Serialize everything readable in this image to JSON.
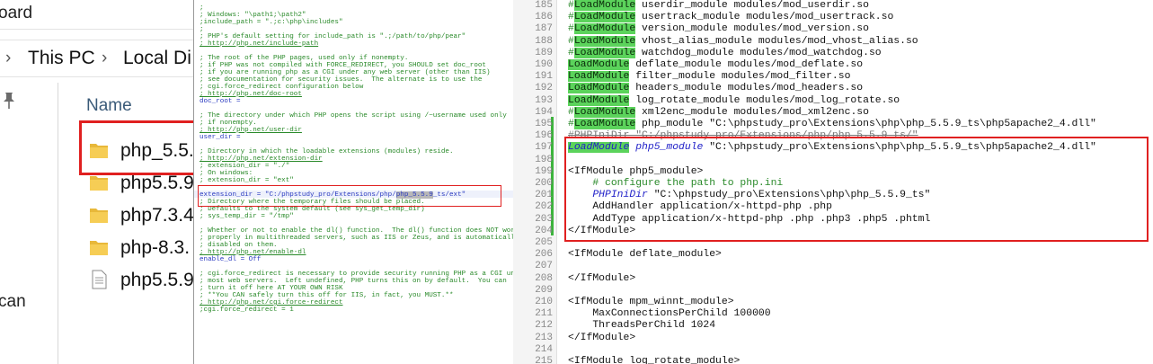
{
  "explorer": {
    "top_partial": "oard",
    "breadcrumb": [
      "This PC",
      "Local Di"
    ],
    "nav_partial": "can",
    "column_header": "Name",
    "files": [
      {
        "name": "php_5.5.",
        "type": "folder"
      },
      {
        "name": "php5.5.9",
        "type": "folder"
      },
      {
        "name": "php7.3.4",
        "type": "folder"
      },
      {
        "name": "php-8.3.",
        "type": "folder"
      },
      {
        "name": "php5.5.9",
        "type": "file"
      }
    ]
  },
  "phpini": {
    "lines": [
      {
        "t": ";",
        "c": "c"
      },
      {
        "t": "; Windows: \"\\path1;\\path2\"",
        "c": "c"
      },
      {
        "t": ";include_path = \".;c:\\php\\includes\"",
        "c": "c"
      },
      {
        "t": ";",
        "c": "c"
      },
      {
        "t": "; PHP's default setting for include_path is \".;/path/to/php/pear\"",
        "c": "c"
      },
      {
        "t": "; http://php.net/include-path",
        "c": "u"
      },
      {
        "t": "",
        "c": "c"
      },
      {
        "t": "; The root of the PHP pages, used only if nonempty.",
        "c": "c"
      },
      {
        "t": "; if PHP was not compiled with FORCE_REDIRECT, you SHOULD set doc_root",
        "c": "c"
      },
      {
        "t": "; if you are running php as a CGI under any web server (other than IIS)",
        "c": "c"
      },
      {
        "t": "; see documentation for security issues.  The alternate is to use the",
        "c": "c"
      },
      {
        "t": "; cgi.force_redirect configuration below",
        "c": "c"
      },
      {
        "t": "; http://php.net/doc-root",
        "c": "u"
      },
      {
        "t": "doc_root =",
        "c": "k"
      },
      {
        "t": "",
        "c": "c"
      },
      {
        "t": "; The directory under which PHP opens the script using /~username used only",
        "c": "c"
      },
      {
        "t": "; if nonempty.",
        "c": "c"
      },
      {
        "t": "; http://php.net/user-dir",
        "c": "u"
      },
      {
        "t": "user_dir =",
        "c": "k"
      },
      {
        "t": "",
        "c": "c"
      },
      {
        "t": "; Directory in which the loadable extensions (modules) reside.",
        "c": "c"
      },
      {
        "t": "; http://php.net/extension-dir",
        "c": "u"
      },
      {
        "t": "; extension_dir = \"./\"",
        "c": "c"
      },
      {
        "t": "; On windows:",
        "c": "c"
      },
      {
        "t": "; extension_dir = \"ext\"",
        "c": "c"
      },
      {
        "t": "",
        "c": "c"
      },
      {
        "t": "; Directory where the temporary files should be placed.",
        "c": "c"
      },
      {
        "t": "; Defaults to the system default (see sys_get_temp_dir)",
        "c": "c"
      },
      {
        "t": "; sys_temp_dir = \"/tmp\"",
        "c": "c"
      },
      {
        "t": "",
        "c": "c"
      },
      {
        "t": "; Whether or not to enable the dl() function.  The dl() function does NOT work",
        "c": "c"
      },
      {
        "t": "; properly in multithreaded servers, such as IIS or Zeus, and is automatically",
        "c": "c"
      },
      {
        "t": "; disabled on them.",
        "c": "c"
      },
      {
        "t": "; http://php.net/enable-dl",
        "c": "u"
      },
      {
        "t": "enable_dl = Off",
        "c": "k"
      },
      {
        "t": "",
        "c": "c"
      },
      {
        "t": "; cgi.force_redirect is necessary to provide security running PHP as a CGI under",
        "c": "c"
      },
      {
        "t": "; most web servers.  Left undefined, PHP turns this on by default.  You can",
        "c": "c"
      },
      {
        "t": "; turn it off here AT YOUR OWN RISK",
        "c": "c"
      },
      {
        "t": "; **You CAN safely turn this off for IIS, in fact, you MUST.**",
        "c": "c"
      },
      {
        "t": "; http://php.net/cgi.force-redirect",
        "c": "u"
      },
      {
        "t": ";cgi.force_redirect = 1",
        "c": "c"
      }
    ],
    "extension_dir_prefix": "extension_dir",
    "extension_dir_eq": " = \"C:/phpstudy_pro/Extensions/php/",
    "extension_dir_hl": "php_5.5.9",
    "extension_dir_suffix": "_ts/ext\""
  },
  "editor": {
    "line_numbers": [
      "185",
      "186",
      "187",
      "188",
      "189",
      "190",
      "191",
      "192",
      "193",
      "194",
      "195",
      "196",
      "197",
      "198",
      "199",
      "200",
      "201",
      "202",
      "203",
      "204",
      "205",
      "206",
      "207",
      "208",
      "209",
      "210",
      "211",
      "212",
      "213",
      "214",
      "215"
    ],
    "lines": [
      {
        "hash": "#",
        "lm": "LoadModule",
        "rest": " userdir_module modules/mod_userdir.so"
      },
      {
        "hash": "#",
        "lm": "LoadModule",
        "rest": " usertrack_module modules/mod_usertrack.so"
      },
      {
        "hash": "#",
        "lm": "LoadModule",
        "rest": " version_module modules/mod_version.so"
      },
      {
        "hash": "#",
        "lm": "LoadModule",
        "rest": " vhost_alias_module modules/mod_vhost_alias.so"
      },
      {
        "hash": "#",
        "lm": "LoadModule",
        "rest": " watchdog_module modules/mod_watchdog.so"
      },
      {
        "hash": "",
        "lm": "LoadModule",
        "rest": " deflate_module modules/mod_deflate.so"
      },
      {
        "hash": "",
        "lm": "LoadModule",
        "rest": " filter_module modules/mod_filter.so"
      },
      {
        "hash": "",
        "lm": "LoadModule",
        "rest": " headers_module modules/mod_headers.so"
      },
      {
        "hash": "",
        "lm": "LoadModule",
        "rest": " log_rotate_module modules/mod_log_rotate.so"
      },
      {
        "hash": "#",
        "lm": "LoadModule",
        "rest": " xml2enc_module modules/mod_xml2enc.so"
      },
      {
        "hash": "#",
        "lm": "LoadModule",
        "rest": " php_module \"C:\\phpstudy_pro\\Extensions\\php\\php_5.5.9_ts\\php5apache2_4.dll\""
      },
      {
        "plain": "#PHPIniDir \"C:/phpstudy_pro/Extensions/php/php_5.5.9_ts/\""
      },
      {
        "lm_it": "LoadModule",
        "it": " php5_module",
        "rest": " \"C:\\phpstudy_pro\\Extensions\\php\\php_5.5.9_ts\\php5apache2_4.dll\""
      },
      {
        "plain": ""
      },
      {
        "plain": "<IfModule php5_module>"
      },
      {
        "cmt": "    # configure the path to php.ini"
      },
      {
        "it2": "    PHPIniDir",
        "rest": " \"C:\\phpstudy_pro\\Extensions\\php\\php_5.5.9_ts\""
      },
      {
        "plain": "    AddHandler application/x-httpd-php .php"
      },
      {
        "plain": "    AddType application/x-httpd-php .php .php3 .php5 .phtml"
      },
      {
        "plain": "</IfModule>"
      },
      {
        "plain": ""
      },
      {
        "plain": "<IfModule deflate_module>"
      },
      {
        "plain": ""
      },
      {
        "plain": "</IfModule>"
      },
      {
        "plain": ""
      },
      {
        "plain": "<IfModule mpm_winnt_module>"
      },
      {
        "plain": "    MaxConnectionsPerChild 100000"
      },
      {
        "plain": "    ThreadsPerChild 1024"
      },
      {
        "plain": "</IfModule>"
      },
      {
        "plain": ""
      },
      {
        "plain": "<IfModule log_rotate_module>"
      }
    ]
  }
}
